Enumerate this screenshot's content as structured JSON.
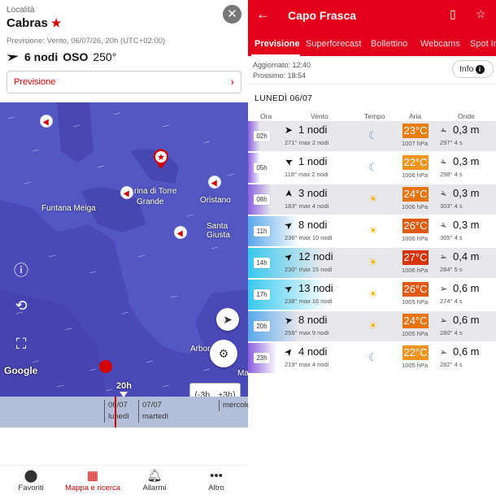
{
  "left": {
    "location_label": "Località",
    "location_name": "Cabras",
    "favorite_star": "★",
    "close_icon": "✕",
    "forecast_line": "Previsione: Vento, 06/07/26, 20h (UTC+02:00)",
    "wind_knots": "6 nodi",
    "wind_dir": "OSO",
    "wind_deg": "250°",
    "previsione_button": "Previsione",
    "map": {
      "places": [
        "Funtana Meiga",
        "rina di Torre",
        "Grande",
        "Oristano",
        "Santa Giusta",
        "Arbor",
        "Ma"
      ],
      "google": "Google",
      "time_marker": "20h",
      "shift_minus": "-3h",
      "shift_plus": "+3h",
      "timeline": [
        {
          "date": "06/07",
          "day": "lunedì"
        },
        {
          "date": "07/07",
          "day": "martedì"
        },
        {
          "date": "",
          "day": "mercole"
        }
      ]
    },
    "nav": [
      {
        "label": "Favoriti",
        "icon": "location-pin-icon"
      },
      {
        "label": "Mappa e ricerca",
        "icon": "map-search-icon"
      },
      {
        "label": "Allarmi",
        "icon": "bell-icon"
      },
      {
        "label": "Altro",
        "icon": "more-icon"
      }
    ]
  },
  "right": {
    "title": "Capo Frasca",
    "tabs": [
      "Previsione",
      "Superforecast",
      "Bollettino",
      "Webcams",
      "Spot Info"
    ],
    "updated": "Aggiornato: 12:40",
    "next": "Prossimo: 18:54",
    "info_button": "Info",
    "day_title": "LUNEDÌ 06/07",
    "columns": [
      "Ora",
      "Vento",
      "Tempo",
      "Aria",
      "Onde"
    ],
    "rows": [
      {
        "hour": "02h",
        "knots": "1 nodi",
        "dir": "271°",
        "max": "max 2 nodi",
        "sky": "moon",
        "temp": "23°C",
        "temp_color": "#e87d0c",
        "press": "1007 hPa",
        "wave": "0,3 m",
        "wave_dir": "297°",
        "period": "4 s"
      },
      {
        "hour": "05h",
        "knots": "1 nodi",
        "dir": "118°",
        "max": "max 2 nodi",
        "sky": "moon",
        "temp": "22°C",
        "temp_color": "#ef9420",
        "press": "1006 hPa",
        "wave": "0,3 m",
        "wave_dir": "298°",
        "period": "4 s"
      },
      {
        "hour": "08h",
        "knots": "3 nodi",
        "dir": "183°",
        "max": "max 4 nodi",
        "sky": "sun",
        "temp": "24°C",
        "temp_color": "#e8730c",
        "press": "1006 hPa",
        "wave": "0,3 m",
        "wave_dir": "303°",
        "period": "4 s"
      },
      {
        "hour": "11h",
        "knots": "8 nodi",
        "dir": "236°",
        "max": "max 10 nodi",
        "sky": "sun",
        "temp": "26°C",
        "temp_color": "#e05a10",
        "press": "1006 hPa",
        "wave": "0,3 m",
        "wave_dir": "305°",
        "period": "4 s"
      },
      {
        "hour": "14h",
        "knots": "12 nodi",
        "dir": "230°",
        "max": "max 15 nodi",
        "sky": "sun",
        "temp": "27°C",
        "temp_color": "#d8340c",
        "press": "1006 hPa",
        "wave": "0,4 m",
        "wave_dir": "284°",
        "period": "5 s"
      },
      {
        "hour": "17h",
        "knots": "13 nodi",
        "dir": "238°",
        "max": "max 16 nodi",
        "sky": "sun",
        "temp": "26°C",
        "temp_color": "#e05a10",
        "press": "1005 hPa",
        "wave": "0,6 m",
        "wave_dir": "274°",
        "period": "4 s"
      },
      {
        "hour": "20h",
        "knots": "8 nodi",
        "dir": "258°",
        "max": "max 9 nodi",
        "sky": "sun",
        "temp": "24°C",
        "temp_color": "#e8730c",
        "press": "1005 hPa",
        "wave": "0,6 m",
        "wave_dir": "280°",
        "period": "4 s"
      },
      {
        "hour": "23h",
        "knots": "4 nodi",
        "dir": "219°",
        "max": "max 4 nodi",
        "sky": "moon",
        "temp": "22°C",
        "temp_color": "#ef9420",
        "press": "1005 hPa",
        "wave": "0,6 m",
        "wave_dir": "282°",
        "period": "4 s"
      }
    ]
  }
}
